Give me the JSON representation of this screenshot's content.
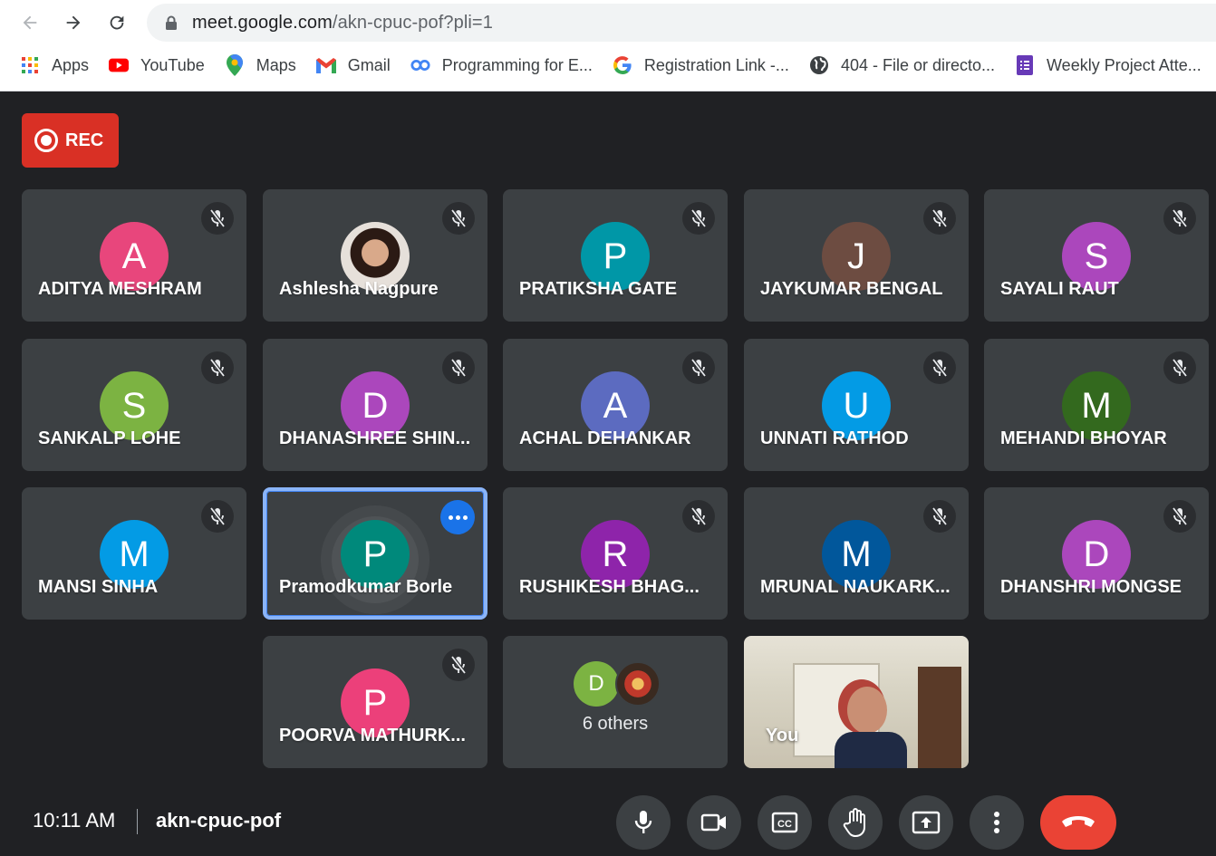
{
  "browser": {
    "url_host": "meet.google.com",
    "url_path": "/akn-cpuc-pof?pli=1",
    "bookmarks": [
      {
        "label": "Apps",
        "icon": "apps-grid-icon"
      },
      {
        "label": "YouTube",
        "icon": "youtube-icon"
      },
      {
        "label": "Maps",
        "icon": "maps-pin-icon"
      },
      {
        "label": "Gmail",
        "icon": "gmail-icon"
      },
      {
        "label": "Programming for E...",
        "icon": "link-icon"
      },
      {
        "label": "Registration Link -...",
        "icon": "google-g-icon"
      },
      {
        "label": "404 - File or directo...",
        "icon": "globe-icon"
      },
      {
        "label": "Weekly Project Atte...",
        "icon": "forms-icon"
      }
    ]
  },
  "meeting": {
    "rec_label": "REC",
    "participants": [
      {
        "name": "ADITYA MESHRAM",
        "initial": "A",
        "color": "#e8467c"
      },
      {
        "name": "Ashlesha Nagpure",
        "initial": "",
        "color": "#5f6368"
      },
      {
        "name": "PRATIKSHA GATE",
        "initial": "P",
        "color": "#0097a7"
      },
      {
        "name": "JAYKUMAR BENGAL",
        "initial": "J",
        "color": "#6d4c41"
      },
      {
        "name": "SAYALI RAUT",
        "initial": "S",
        "color": "#ab47bc"
      },
      {
        "name": "SANKALP LOHE",
        "initial": "S",
        "color": "#7cb342"
      },
      {
        "name": "DHANASHREE SHIN...",
        "initial": "D",
        "color": "#ab47bc"
      },
      {
        "name": "ACHAL DEHANKAR",
        "initial": "A",
        "color": "#5c6bc0"
      },
      {
        "name": "UNNATI RATHOD",
        "initial": "U",
        "color": "#039be5"
      },
      {
        "name": "MEHANDI BHOYAR",
        "initial": "M",
        "color": "#33691e"
      },
      {
        "name": "MANSI SINHA",
        "initial": "M",
        "color": "#039be5"
      },
      {
        "name": "Pramodkumar Borle",
        "initial": "P",
        "color": "#00897b"
      },
      {
        "name": "RUSHIKESH BHAG...",
        "initial": "R",
        "color": "#8e24aa"
      },
      {
        "name": "MRUNAL NAUKARK...",
        "initial": "M",
        "color": "#01579b"
      },
      {
        "name": "DHANSHRI MONGSE",
        "initial": "D",
        "color": "#ab47bc"
      },
      {
        "name": "POORVA MATHURK...",
        "initial": "P",
        "color": "#ec407a"
      }
    ],
    "others": {
      "label": "6 others",
      "initial": "D",
      "color": "#7cb342"
    },
    "self_label": "You",
    "time": "10:11 AM",
    "meeting_code": "akn-cpuc-pof"
  },
  "colors": {
    "background": "#202124",
    "tile": "#3c4043",
    "rec": "#d93025",
    "end_call": "#ea4335",
    "active_outline": "#8ab4f8"
  }
}
